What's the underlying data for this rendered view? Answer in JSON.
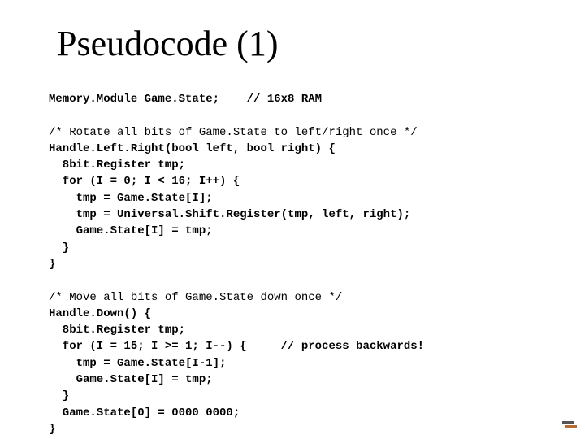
{
  "title": "Pseudocode (1)",
  "code": {
    "l01": "Memory.Module Game.State;    // 16x8 RAM",
    "l02": "",
    "l03": "/* Rotate all bits of Game.State to left/right once */",
    "l04": "Handle.Left.Right(bool left, bool right) {",
    "l05": "  8bit.Register tmp;",
    "l06": "  for (I = 0; I < 16; I++) {",
    "l07": "    tmp = Game.State[I];",
    "l08": "    tmp = Universal.Shift.Register(tmp, left, right);",
    "l09": "    Game.State[I] = tmp;",
    "l10": "  }",
    "l11": "}",
    "l12": "",
    "l13": "/* Move all bits of Game.State down once */",
    "l14": "Handle.Down() {",
    "l15": "  8bit.Register tmp;",
    "l16": "  for (I = 15; I >= 1; I--) {     // process backwards!",
    "l17": "    tmp = Game.State[I-1];",
    "l18": "    Game.State[I] = tmp;",
    "l19": "  }",
    "l20": "  Game.State[0] = 0000 0000;",
    "l21": "}"
  }
}
